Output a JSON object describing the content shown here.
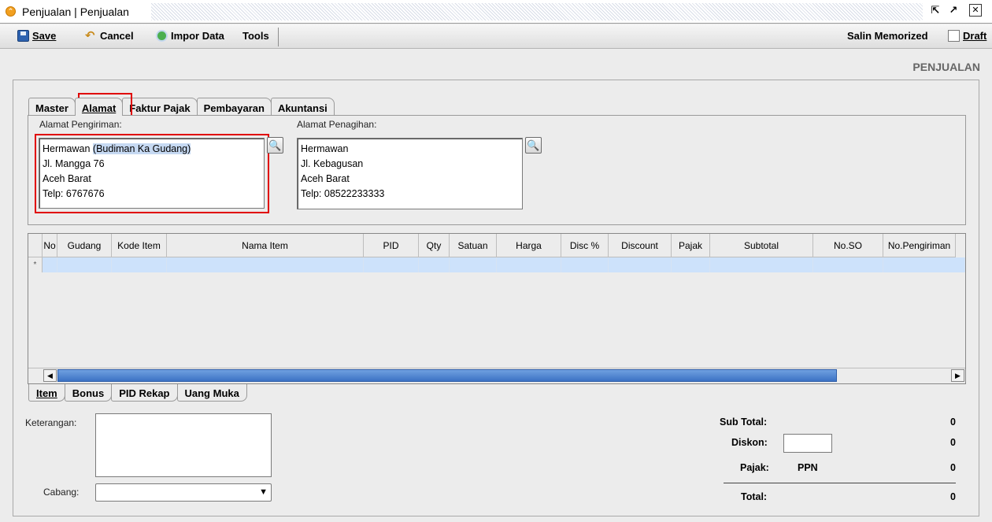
{
  "window": {
    "title": "Penjualan | Penjualan"
  },
  "toolbar": {
    "save": "Save",
    "cancel": "Cancel",
    "impor": "Impor Data",
    "tools": "Tools",
    "salin": "Salin Memorized",
    "draft": "Draft"
  },
  "page": {
    "header": "PENJUALAN"
  },
  "tabs_top": [
    "Master",
    "Alamat",
    "Faktur Pajak",
    "Pembayaran",
    "Akuntansi"
  ],
  "alamat": {
    "pengiriman_label": "Alamat Pengiriman:",
    "pengiriman_name": "Hermawan ",
    "pengiriman_selected": "(Budiman Ka Gudang)",
    "pengiriman_lines": [
      "Jl. Mangga 76",
      "Aceh Barat",
      "Telp: 6767676"
    ],
    "penagihan_label": "Alamat Penagihan:",
    "penagihan_lines": [
      "Hermawan",
      "Jl. Kebagusan",
      "Aceh Barat",
      "Telp: 08522233333"
    ]
  },
  "grid": {
    "columns": [
      "No",
      "Gudang",
      "Kode Item",
      "Nama Item",
      "PID",
      "Qty",
      "Satuan",
      "Harga",
      "Disc %",
      "Discount",
      "Pajak",
      "Subtotal",
      "No.SO",
      "No.Pengiriman"
    ],
    "new_row_marker": "*"
  },
  "tabs_bottom": [
    "Item",
    "Bonus",
    "PID Rekap",
    "Uang Muka"
  ],
  "form": {
    "keterangan_label": "Keterangan:",
    "cabang_label": "Cabang:",
    "cabang_value": ""
  },
  "summary": {
    "subtotal_label": "Sub Total:",
    "subtotal_value": "0",
    "diskon_label": "Diskon:",
    "diskon_value": "0",
    "pajak_label": "Pajak:",
    "pajak_type": "PPN",
    "pajak_value": "0",
    "total_label": "Total:",
    "total_value": "0"
  }
}
